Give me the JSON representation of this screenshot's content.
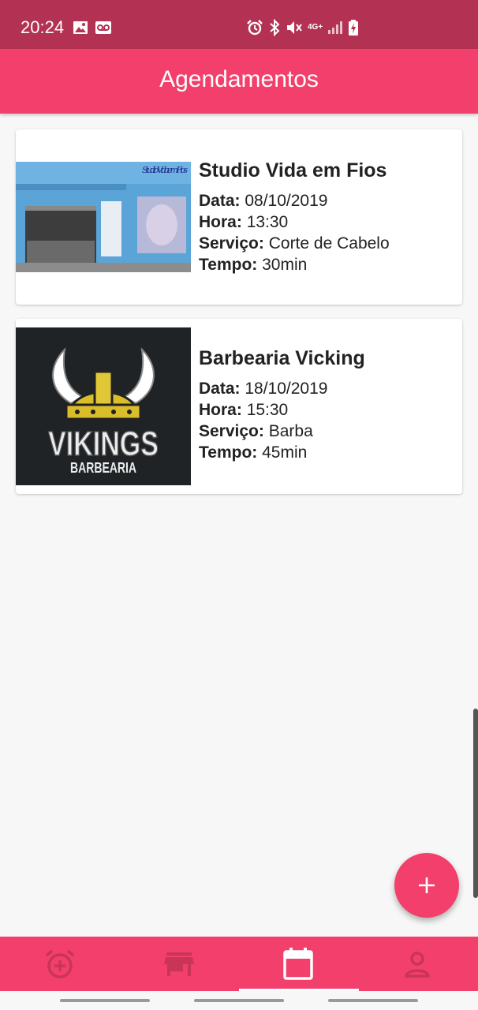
{
  "status_bar": {
    "time": "20:24",
    "left_icons": [
      "image-icon",
      "voicemail-icon"
    ],
    "right_icons": [
      "alarm-icon",
      "bluetooth-icon",
      "mute-icon",
      "network-4g-icon",
      "signal-icon",
      "battery-charging-icon"
    ],
    "network_label": "4G+"
  },
  "header": {
    "title": "Agendamentos"
  },
  "appointments": [
    {
      "name": "Studio Vida em Fios",
      "image_sign": "Studio Vida em Fios",
      "data_label": "Data:",
      "data": "08/10/2019",
      "hora_label": "Hora:",
      "hora": "13:30",
      "servico_label": "Serviço:",
      "servico": "Corte de Cabelo",
      "tempo_label": "Tempo:",
      "tempo": "30min"
    },
    {
      "name": "Barbearia Vicking",
      "image_logo_main": "VIKINGS",
      "image_logo_sub": "BARBEARIA",
      "data_label": "Data:",
      "data": "18/10/2019",
      "hora_label": "Hora:",
      "hora": "15:30",
      "servico_label": "Serviço:",
      "servico": "Barba",
      "tempo_label": "Tempo:",
      "tempo": "45min"
    }
  ],
  "fab": {
    "icon": "plus-icon"
  },
  "bottom_nav": {
    "items": [
      {
        "icon": "alarm-add-icon",
        "active": false
      },
      {
        "icon": "store-icon",
        "active": false
      },
      {
        "icon": "calendar-icon",
        "active": true
      },
      {
        "icon": "person-icon",
        "active": false
      }
    ]
  },
  "colors": {
    "status_bar": "#b33152",
    "primary": "#f23f6c",
    "inactive_icon": "#c93556",
    "active_icon": "#ffffff",
    "background": "#f7f7f7"
  }
}
